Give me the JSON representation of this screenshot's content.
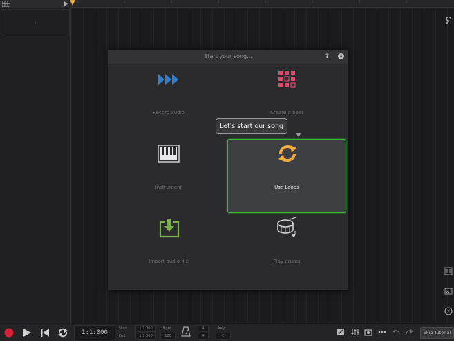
{
  "dialog": {
    "title": "Start your song...",
    "help": "?",
    "close": "×",
    "options": [
      {
        "label": "Record audio",
        "icon": "fast-forward-icon",
        "color": "#2f7fd1"
      },
      {
        "label": "Create a beat",
        "icon": "beat-grid-icon",
        "color": "#d94a6d"
      },
      {
        "label": "Instrument",
        "icon": "piano-keys-icon",
        "color": "#cfcfd1"
      },
      {
        "label": "Use Loops",
        "icon": "loop-refresh-icon",
        "color": "#f3a93c",
        "selected": true
      },
      {
        "label": "Import audio file",
        "icon": "import-download-icon",
        "color": "#78b04a"
      },
      {
        "label": "Play drums",
        "icon": "drum-icon",
        "color": "#cfcfd1"
      }
    ],
    "tooltip": "Let's start our song"
  },
  "transport": {
    "time": "1:1:000",
    "start_label": "Start",
    "end_label": "End",
    "start_value": "1:1:000",
    "end_value": "1:1:000",
    "bpm_label": "Bpm",
    "bpm_value": "120",
    "sig_top": "4",
    "sig_bottom": "4",
    "key_label": "Key",
    "key_value": "C",
    "skip_label": "Skip Tutorial"
  },
  "colors": {
    "record": "#d6223a",
    "accent_green": "#3fb43f",
    "playhead": "#e2a93a"
  }
}
